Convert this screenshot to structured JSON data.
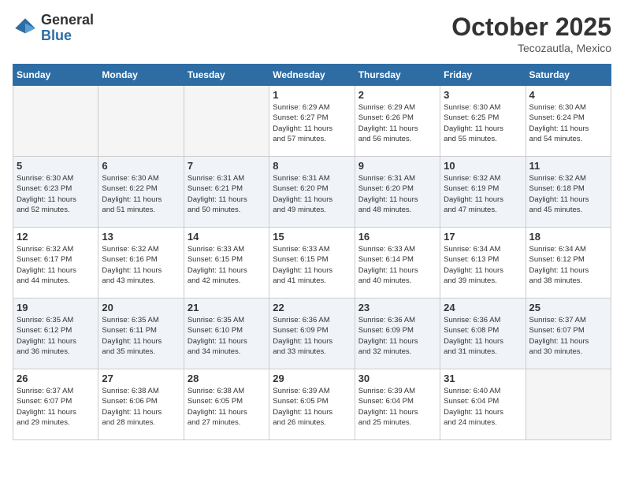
{
  "header": {
    "logo_general": "General",
    "logo_blue": "Blue",
    "month_title": "October 2025",
    "location": "Tecozautla, Mexico"
  },
  "weekdays": [
    "Sunday",
    "Monday",
    "Tuesday",
    "Wednesday",
    "Thursday",
    "Friday",
    "Saturday"
  ],
  "rows": [
    {
      "cells": [
        {
          "empty": true
        },
        {
          "empty": true
        },
        {
          "empty": true
        },
        {
          "day": "1",
          "info": "Sunrise: 6:29 AM\nSunset: 6:27 PM\nDaylight: 11 hours\nand 57 minutes."
        },
        {
          "day": "2",
          "info": "Sunrise: 6:29 AM\nSunset: 6:26 PM\nDaylight: 11 hours\nand 56 minutes."
        },
        {
          "day": "3",
          "info": "Sunrise: 6:30 AM\nSunset: 6:25 PM\nDaylight: 11 hours\nand 55 minutes."
        },
        {
          "day": "4",
          "info": "Sunrise: 6:30 AM\nSunset: 6:24 PM\nDaylight: 11 hours\nand 54 minutes."
        }
      ]
    },
    {
      "cells": [
        {
          "day": "5",
          "info": "Sunrise: 6:30 AM\nSunset: 6:23 PM\nDaylight: 11 hours\nand 52 minutes."
        },
        {
          "day": "6",
          "info": "Sunrise: 6:30 AM\nSunset: 6:22 PM\nDaylight: 11 hours\nand 51 minutes."
        },
        {
          "day": "7",
          "info": "Sunrise: 6:31 AM\nSunset: 6:21 PM\nDaylight: 11 hours\nand 50 minutes."
        },
        {
          "day": "8",
          "info": "Sunrise: 6:31 AM\nSunset: 6:20 PM\nDaylight: 11 hours\nand 49 minutes."
        },
        {
          "day": "9",
          "info": "Sunrise: 6:31 AM\nSunset: 6:20 PM\nDaylight: 11 hours\nand 48 minutes."
        },
        {
          "day": "10",
          "info": "Sunrise: 6:32 AM\nSunset: 6:19 PM\nDaylight: 11 hours\nand 47 minutes."
        },
        {
          "day": "11",
          "info": "Sunrise: 6:32 AM\nSunset: 6:18 PM\nDaylight: 11 hours\nand 45 minutes."
        }
      ]
    },
    {
      "cells": [
        {
          "day": "12",
          "info": "Sunrise: 6:32 AM\nSunset: 6:17 PM\nDaylight: 11 hours\nand 44 minutes."
        },
        {
          "day": "13",
          "info": "Sunrise: 6:32 AM\nSunset: 6:16 PM\nDaylight: 11 hours\nand 43 minutes."
        },
        {
          "day": "14",
          "info": "Sunrise: 6:33 AM\nSunset: 6:15 PM\nDaylight: 11 hours\nand 42 minutes."
        },
        {
          "day": "15",
          "info": "Sunrise: 6:33 AM\nSunset: 6:15 PM\nDaylight: 11 hours\nand 41 minutes."
        },
        {
          "day": "16",
          "info": "Sunrise: 6:33 AM\nSunset: 6:14 PM\nDaylight: 11 hours\nand 40 minutes."
        },
        {
          "day": "17",
          "info": "Sunrise: 6:34 AM\nSunset: 6:13 PM\nDaylight: 11 hours\nand 39 minutes."
        },
        {
          "day": "18",
          "info": "Sunrise: 6:34 AM\nSunset: 6:12 PM\nDaylight: 11 hours\nand 38 minutes."
        }
      ]
    },
    {
      "cells": [
        {
          "day": "19",
          "info": "Sunrise: 6:35 AM\nSunset: 6:12 PM\nDaylight: 11 hours\nand 36 minutes."
        },
        {
          "day": "20",
          "info": "Sunrise: 6:35 AM\nSunset: 6:11 PM\nDaylight: 11 hours\nand 35 minutes."
        },
        {
          "day": "21",
          "info": "Sunrise: 6:35 AM\nSunset: 6:10 PM\nDaylight: 11 hours\nand 34 minutes."
        },
        {
          "day": "22",
          "info": "Sunrise: 6:36 AM\nSunset: 6:09 PM\nDaylight: 11 hours\nand 33 minutes."
        },
        {
          "day": "23",
          "info": "Sunrise: 6:36 AM\nSunset: 6:09 PM\nDaylight: 11 hours\nand 32 minutes."
        },
        {
          "day": "24",
          "info": "Sunrise: 6:36 AM\nSunset: 6:08 PM\nDaylight: 11 hours\nand 31 minutes."
        },
        {
          "day": "25",
          "info": "Sunrise: 6:37 AM\nSunset: 6:07 PM\nDaylight: 11 hours\nand 30 minutes."
        }
      ]
    },
    {
      "cells": [
        {
          "day": "26",
          "info": "Sunrise: 6:37 AM\nSunset: 6:07 PM\nDaylight: 11 hours\nand 29 minutes."
        },
        {
          "day": "27",
          "info": "Sunrise: 6:38 AM\nSunset: 6:06 PM\nDaylight: 11 hours\nand 28 minutes."
        },
        {
          "day": "28",
          "info": "Sunrise: 6:38 AM\nSunset: 6:05 PM\nDaylight: 11 hours\nand 27 minutes."
        },
        {
          "day": "29",
          "info": "Sunrise: 6:39 AM\nSunset: 6:05 PM\nDaylight: 11 hours\nand 26 minutes."
        },
        {
          "day": "30",
          "info": "Sunrise: 6:39 AM\nSunset: 6:04 PM\nDaylight: 11 hours\nand 25 minutes."
        },
        {
          "day": "31",
          "info": "Sunrise: 6:40 AM\nSunset: 6:04 PM\nDaylight: 11 hours\nand 24 minutes."
        },
        {
          "empty": true
        }
      ]
    }
  ]
}
